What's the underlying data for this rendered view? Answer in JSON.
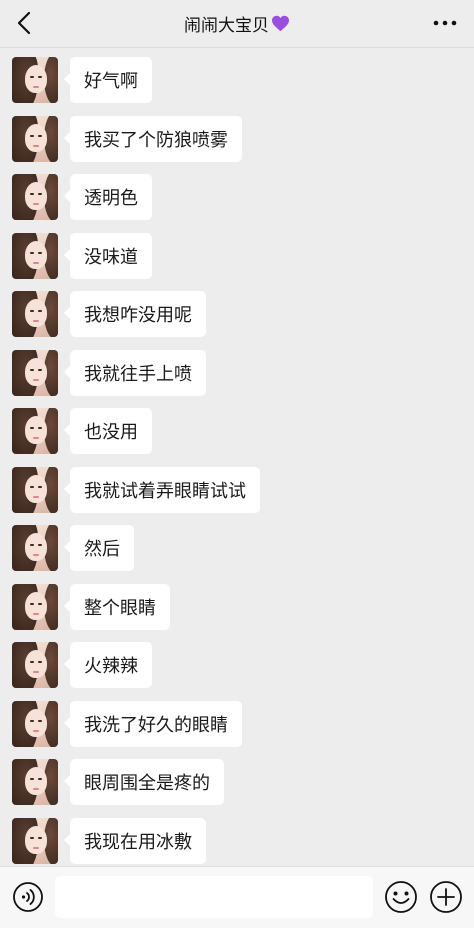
{
  "header": {
    "title": "闹闹大宝贝",
    "title_emoji": "purple-heart-icon",
    "back_icon": "chevron-left-icon",
    "more_icon": "more-dots-icon"
  },
  "messages": [
    {
      "text": "好气啊"
    },
    {
      "text": "我买了个防狼喷雾"
    },
    {
      "text": "透明色"
    },
    {
      "text": "没味道"
    },
    {
      "text": "我想咋没用呢"
    },
    {
      "text": "我就往手上喷"
    },
    {
      "text": "也没用"
    },
    {
      "text": "我就试着弄眼睛试试"
    },
    {
      "text": "然后"
    },
    {
      "text": "整个眼睛"
    },
    {
      "text": "火辣辣"
    },
    {
      "text": "我洗了好久的眼睛"
    },
    {
      "text": "眼周围全是疼的"
    },
    {
      "text": "我现在用冰敷"
    }
  ],
  "input_bar": {
    "voice_icon": "voice-icon",
    "input_value": "",
    "emoji_icon": "emoji-icon",
    "plus_icon": "plus-icon"
  },
  "colors": {
    "background": "#ededed",
    "bubble": "#ffffff",
    "heart": "#9b4dde"
  }
}
